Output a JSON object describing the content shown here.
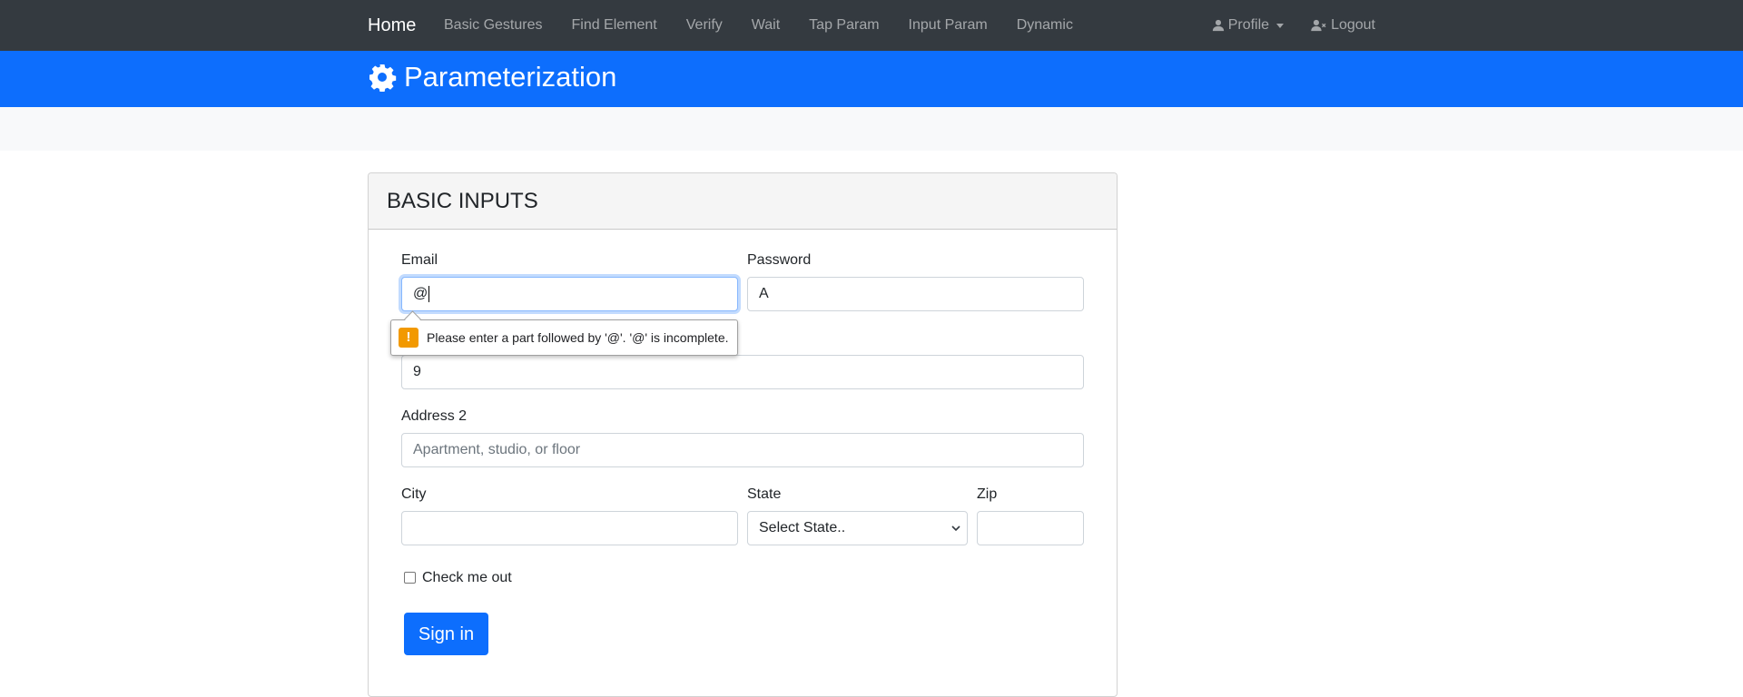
{
  "navbar": {
    "brand": "Home",
    "links": [
      "Basic Gestures",
      "Find Element",
      "Verify",
      "Wait",
      "Tap Param",
      "Input Param",
      "Dynamic"
    ],
    "profile_label": "Profile",
    "logout_label": "Logout"
  },
  "header": {
    "title": "Parameterization",
    "icon": "gear-icon"
  },
  "card": {
    "title": "BASIC INPUTS"
  },
  "form": {
    "email_label": "Email",
    "email_value": "@",
    "password_label": "Password",
    "password_value": "A",
    "address_value": "9",
    "address2_label": "Address 2",
    "address2_placeholder": "Apartment, studio, or floor",
    "city_label": "City",
    "city_value": "",
    "state_label": "State",
    "state_selected": "Select State..",
    "zip_label": "Zip",
    "zip_value": "",
    "checkbox_label": "Check me out",
    "submit_label": "Sign in"
  },
  "validation": {
    "message": "Please enter a part followed by '@'. '@' is incomplete.",
    "icon": "warning-icon"
  },
  "colors": {
    "navbar": "#343a40",
    "primary": "#0d6efd",
    "warning": "#f29900"
  }
}
